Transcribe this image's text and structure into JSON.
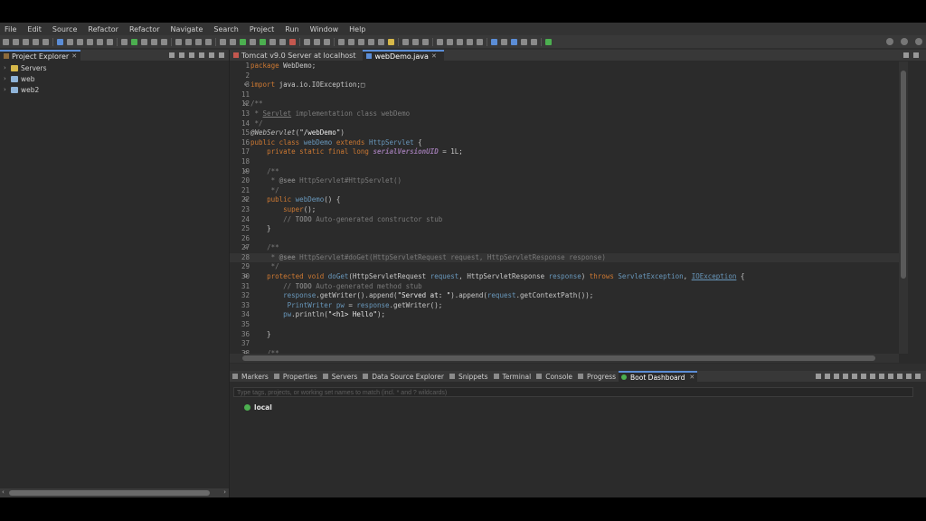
{
  "menu": [
    "File",
    "Edit",
    "Source",
    "Refactor",
    "Refactor",
    "Navigate",
    "Search",
    "Project",
    "Run",
    "Window",
    "Help"
  ],
  "project_explorer": {
    "title": "Project Explorer",
    "items": [
      {
        "label": "Servers"
      },
      {
        "label": "web"
      },
      {
        "label": "web2"
      }
    ]
  },
  "editor": {
    "tabs": [
      "Tomcat v9.0 Server at localhost",
      "webDemo.java"
    ],
    "lines": [
      {
        "n": "1",
        "html": "<span class=\"kw\">package</span> WebDemo;"
      },
      {
        "n": "2",
        "html": ""
      },
      {
        "n": "3",
        "html": "<span class=\"kw\">import</span> java.io.IOException;&#9633;"
      },
      {
        "n": "11",
        "html": ""
      },
      {
        "n": "12",
        "html": "<span class=\"cm\">/**</span>"
      },
      {
        "n": "13",
        "html": "<span class=\"cm\"> * <u>Servlet</u> implementation class webDemo</span>"
      },
      {
        "n": "14",
        "html": "<span class=\"cm\"> */</span>"
      },
      {
        "n": "15",
        "html": "<span class=\"an\">@WebServlet</span>(<span class=\"st\">\"/webDemo\"</span>)"
      },
      {
        "n": "16",
        "html": "<span class=\"kw\">public class</span> <span class=\"ty\">webDemo</span> <span class=\"kw\">extends</span> <span class=\"ty\">HttpServlet</span> {"
      },
      {
        "n": "17",
        "html": "    <span class=\"kw\">private static final long</span> <span class=\"fi\">serialVersionUID</span> = 1L;"
      },
      {
        "n": "18",
        "html": ""
      },
      {
        "n": "19",
        "html": "    <span class=\"cm\">/**</span>"
      },
      {
        "n": "20",
        "html": "<span class=\"cm\">     * <b>@see</b> HttpServlet#HttpServlet()</span>"
      },
      {
        "n": "21",
        "html": "<span class=\"cm\">     */</span>"
      },
      {
        "n": "22",
        "html": "    <span class=\"kw\">public</span> <span class=\"ty\">webDemo</span>() {"
      },
      {
        "n": "23",
        "html": "        <span class=\"kw\">super</span>();"
      },
      {
        "n": "24",
        "html": "        <span class=\"cm\">// <b>TODO</b> Auto-generated constructor stub</span>"
      },
      {
        "n": "25",
        "html": "    }"
      },
      {
        "n": "26",
        "html": ""
      },
      {
        "n": "27",
        "html": "    <span class=\"cm\">/**</span>"
      },
      {
        "n": "28",
        "html": "<span class=\"cm\">     * <b>@see</b> HttpServlet#doGet(HttpServletRequest request, HttpServletResponse response)</span>"
      },
      {
        "n": "29",
        "html": "<span class=\"cm\">     */</span>"
      },
      {
        "n": "30",
        "html": "    <span class=\"kw\">protected void</span> <span class=\"ty\">doGet</span>(HttpServletRequest <span class=\"ty\">request</span>, HttpServletResponse <span class=\"ty\">response</span>) <span class=\"kw\">throws</span> <span class=\"ty\">ServletException</span>, <span class=\"ty\"><u>IOException</u></span> {"
      },
      {
        "n": "31",
        "html": "        <span class=\"cm\">// <b>TODO</b> Auto-generated method stub</span>"
      },
      {
        "n": "32",
        "html": "        <span class=\"ty\">response</span>.getWriter().append(<span class=\"st\">\"Served at: \"</span>).append(<span class=\"ty\">request</span>.getContextPath());"
      },
      {
        "n": "33",
        "html": "         <span class=\"ty\">PrintWriter</span> <span class=\"ty\">pw</span> = <span class=\"ty\">response</span>.getWriter();"
      },
      {
        "n": "34",
        "html": "        <span class=\"ty\">pw</span>.println(<span class=\"st\">\"&lt;h1&gt; Hello\"</span>);"
      },
      {
        "n": "35",
        "html": ""
      },
      {
        "n": "36",
        "html": "    }"
      },
      {
        "n": "37",
        "html": ""
      },
      {
        "n": "38",
        "html": "    <span class=\"cm\">/**</span>"
      }
    ]
  },
  "bottom": {
    "tabs": [
      "Markers",
      "Properties",
      "Servers",
      "Data Source Explorer",
      "Snippets",
      "Terminal",
      "Console",
      "Progress",
      "Boot Dashboard"
    ],
    "active_tab": "Boot Dashboard",
    "filter_placeholder": "Type tags, projects, or working set names to match (incl. * and ? wildcards)",
    "local": "local"
  },
  "colors": {
    "accent": "#5b8dd6",
    "keyword": "#cc7832",
    "type": "#6897bb",
    "comment": "#7a7a7a",
    "running": "#4caf50"
  }
}
